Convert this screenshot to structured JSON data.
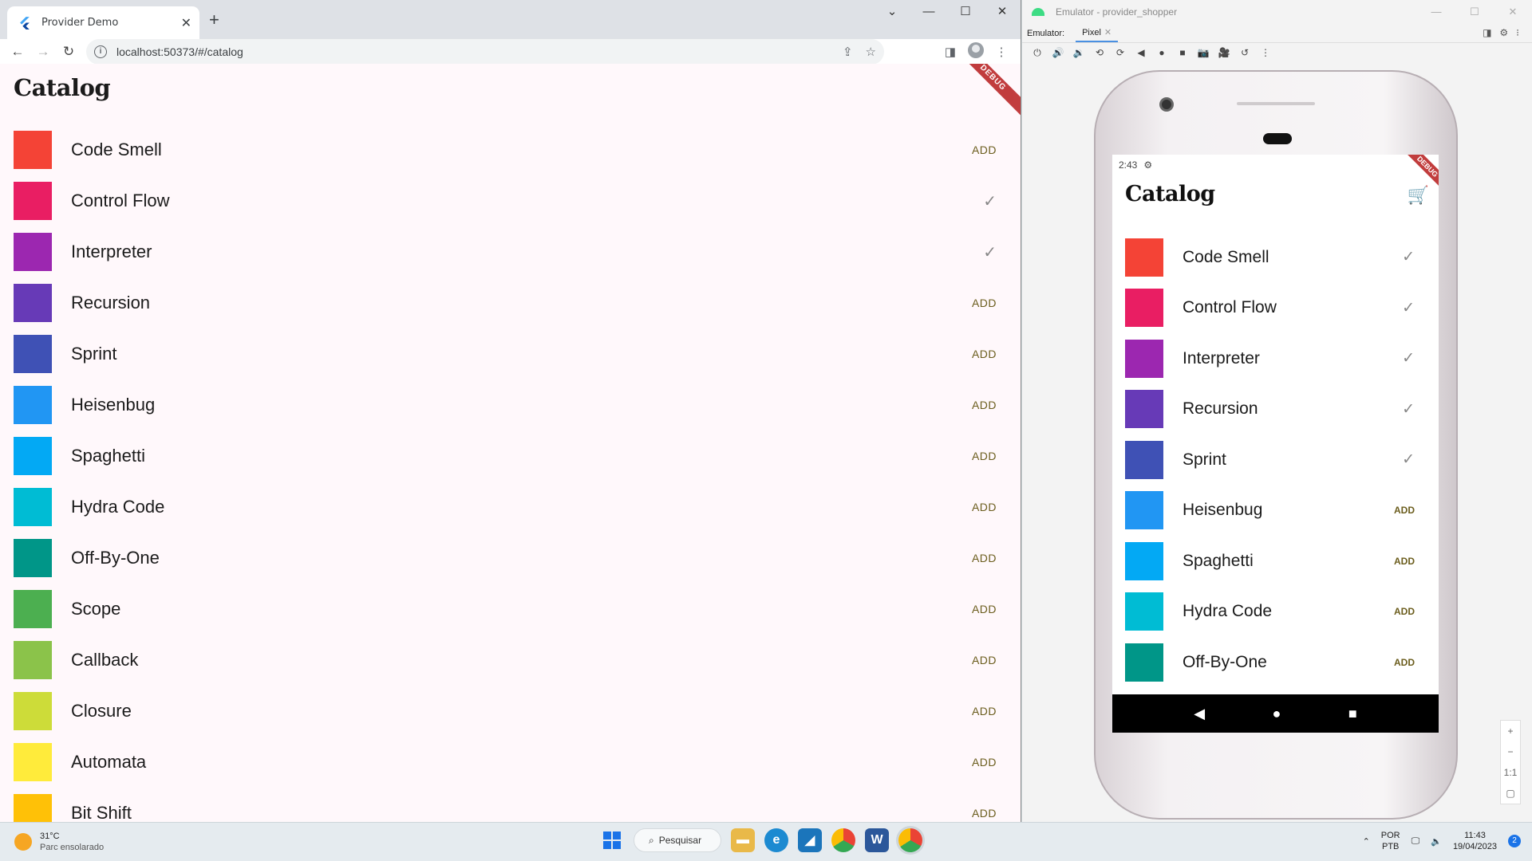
{
  "browser": {
    "tab_title": "Provider Demo",
    "tab_close": "✕",
    "new_tab": "+",
    "url": "localhost:50373/#/catalog",
    "win_controls": [
      "⌄",
      "—",
      "☐",
      "✕"
    ]
  },
  "web": {
    "title": "Catalog",
    "debug_banner": "DEBUG",
    "add_label": "ADD",
    "items": [
      {
        "name": "Code Smell",
        "color": "#f44336",
        "in_cart": false
      },
      {
        "name": "Control Flow",
        "color": "#e91e63",
        "in_cart": true
      },
      {
        "name": "Interpreter",
        "color": "#9c27b0",
        "in_cart": true
      },
      {
        "name": "Recursion",
        "color": "#673ab7",
        "in_cart": false
      },
      {
        "name": "Sprint",
        "color": "#3f51b5",
        "in_cart": false
      },
      {
        "name": "Heisenbug",
        "color": "#2196f3",
        "in_cart": false
      },
      {
        "name": "Spaghetti",
        "color": "#03a9f4",
        "in_cart": false
      },
      {
        "name": "Hydra Code",
        "color": "#00bcd4",
        "in_cart": false
      },
      {
        "name": "Off-By-One",
        "color": "#009688",
        "in_cart": false
      },
      {
        "name": "Scope",
        "color": "#4caf50",
        "in_cart": false
      },
      {
        "name": "Callback",
        "color": "#8bc34a",
        "in_cart": false
      },
      {
        "name": "Closure",
        "color": "#cddc39",
        "in_cart": false
      },
      {
        "name": "Automata",
        "color": "#ffeb3b",
        "in_cart": false
      },
      {
        "name": "Bit Shift",
        "color": "#ffc107",
        "in_cart": false
      }
    ]
  },
  "emulator": {
    "window_title": "Emulator - provider_shopper",
    "label": "Emulator:",
    "device_tab": "Pixel",
    "status_time": "2:43",
    "app_title": "Catalog",
    "zoom_1to1": "1:1",
    "items": [
      {
        "name": "Code Smell",
        "color": "#f44336",
        "in_cart": true
      },
      {
        "name": "Control Flow",
        "color": "#e91e63",
        "in_cart": true
      },
      {
        "name": "Interpreter",
        "color": "#9c27b0",
        "in_cart": true
      },
      {
        "name": "Recursion",
        "color": "#673ab7",
        "in_cart": true
      },
      {
        "name": "Sprint",
        "color": "#3f51b5",
        "in_cart": true
      },
      {
        "name": "Heisenbug",
        "color": "#2196f3",
        "in_cart": false
      },
      {
        "name": "Spaghetti",
        "color": "#03a9f4",
        "in_cart": false
      },
      {
        "name": "Hydra Code",
        "color": "#00bcd4",
        "in_cart": false
      },
      {
        "name": "Off-By-One",
        "color": "#009688",
        "in_cart": false
      }
    ]
  },
  "taskbar": {
    "temp": "31°C",
    "weather": "Parc ensolarado",
    "search": "Pesquisar",
    "lang1": "POR",
    "lang2": "PTB",
    "time": "11:43",
    "date": "19/04/2023",
    "notifications": "2"
  }
}
